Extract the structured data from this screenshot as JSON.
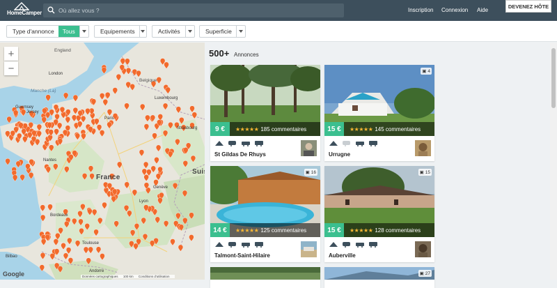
{
  "header": {
    "logo_text": "HomeCamper",
    "search_placeholder": "Où allez vous ?",
    "nav": [
      "Inscription",
      "Connexion",
      "Aide"
    ],
    "cta": "DEVENEZ HÔTE"
  },
  "filters": {
    "type_label": "Type d'annonce",
    "type_value": "Tous",
    "equipements": "Equipements",
    "activites": "Activités",
    "superficie": "Superficie"
  },
  "map": {
    "labels": {
      "england": "England",
      "london": "London",
      "guernsey": "Guernsey",
      "jersey": "Jersey",
      "paris": "Paris",
      "belgique": "Belgique",
      "luxembourg": "Luxembourg",
      "strasbourg": "Strasbourg",
      "nantes": "Nantes",
      "bordeaux": "Bordeaux",
      "lyon": "Lyon",
      "geneve": "Genève",
      "france": "France",
      "suisse": "Suis",
      "toulouse": "Toulouse",
      "bilbao": "Bilbao",
      "andorre": "Andorre",
      "manche": "Manche (La)"
    },
    "google": "Google",
    "attribution": [
      "Données cartographiques",
      "100 km",
      "Conditions d'utilisation"
    ]
  },
  "results": {
    "count": "500+",
    "count_label": "Annonces",
    "listings": [
      {
        "title": "St Gildas De Rhuys",
        "price": "9 €",
        "reviews": "185 commentaires",
        "photos": "",
        "stars": "★★★★★"
      },
      {
        "title": "Urrugne",
        "price": "15 €",
        "reviews": "145 commentaires",
        "photos": "4",
        "stars": "★★★★★"
      },
      {
        "title": "Talmont-Saint-Hilaire",
        "price": "14 €",
        "reviews": "125 commentaires",
        "photos": "16",
        "stars": "★★★★★"
      },
      {
        "title": "Auberville",
        "price": "15 €",
        "reviews": "128 commentaires",
        "photos": "15",
        "stars": "★★★★★"
      },
      {
        "title": "",
        "price": "",
        "reviews": "",
        "photos": "",
        "stars": ""
      },
      {
        "title": "",
        "price": "",
        "reviews": "",
        "photos": "27",
        "stars": ""
      }
    ]
  },
  "colors": {
    "header": "#3d4f5c",
    "accent": "#3bbf8f",
    "pin": "#f26a2c",
    "star": "#f7b733"
  }
}
